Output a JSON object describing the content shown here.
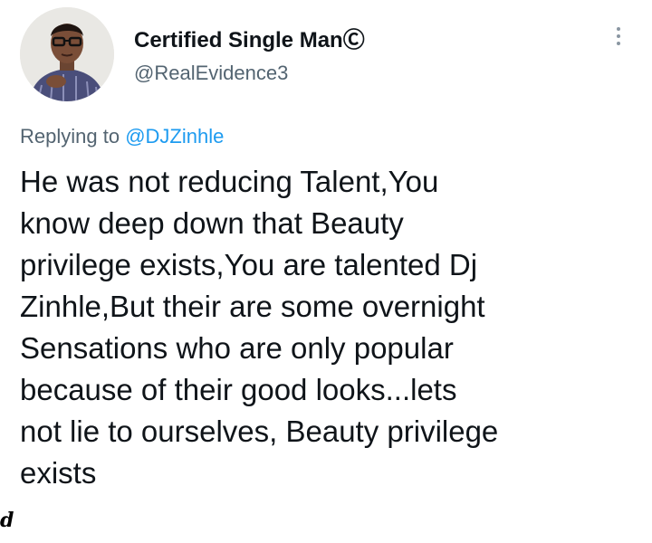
{
  "author": {
    "display_name": "Certified Single ManⒸ",
    "handle": "@RealEvidence3",
    "avatar_icon": "profile-photo-man-glasses"
  },
  "reply": {
    "prefix": "Replying to ",
    "mention": "@DJZinhle"
  },
  "tweet": {
    "lines": [
      "He was not reducing Talent,You",
      "know deep down that Beauty",
      "privilege exists,You are talented Dj",
      "Zinhle,But their are some overnight",
      "Sensations who are only popular",
      "because of their good looks...lets",
      "not lie to ourselves, Beauty privilege",
      "exists"
    ]
  },
  "menu": {
    "icon": "more-vertical-icon"
  },
  "edge_mark": "d",
  "colors": {
    "text": "#0f1419",
    "secondary": "#536471",
    "link": "#1d9bf0",
    "background": "#ffffff"
  }
}
